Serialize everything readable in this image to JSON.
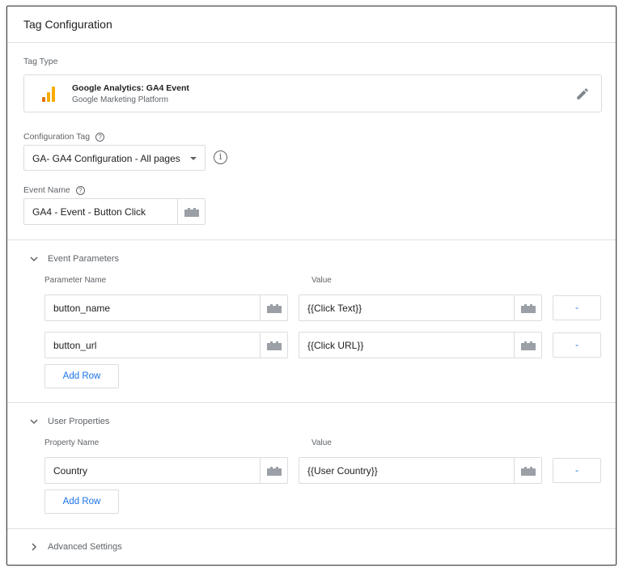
{
  "header": {
    "title": "Tag Configuration"
  },
  "tag_type": {
    "label": "Tag Type",
    "name": "Google Analytics: GA4 Event",
    "platform": "Google Marketing Platform",
    "icon": "google-analytics-bars",
    "icon_colors": [
      "#f9ab00",
      "#e37400"
    ]
  },
  "config_tag": {
    "label": "Configuration Tag",
    "help_glyph": "?",
    "selected": "GA- GA4 Configuration - All pages",
    "info_glyph": "i"
  },
  "event_name": {
    "label": "Event Name",
    "help_glyph": "?",
    "value": "GA4 - Event - Button Click"
  },
  "event_parameters": {
    "title": "Event Parameters",
    "col_name": "Parameter Name",
    "col_value": "Value",
    "rows": [
      {
        "name": "button_name",
        "value": "{{Click Text}}",
        "remove": "-"
      },
      {
        "name": "button_url",
        "value": "{{Click URL}}",
        "remove": "-"
      }
    ],
    "add_row": "Add Row"
  },
  "user_properties": {
    "title": "User Properties",
    "col_name": "Property Name",
    "col_value": "Value",
    "rows": [
      {
        "name": "Country",
        "value": "{{User Country}}",
        "remove": "-"
      }
    ],
    "add_row": "Add Row"
  },
  "advanced": {
    "title": "Advanced Settings"
  },
  "colors": {
    "accent": "#1a73e8",
    "border": "#dadce0",
    "muted": "#5f6368"
  }
}
